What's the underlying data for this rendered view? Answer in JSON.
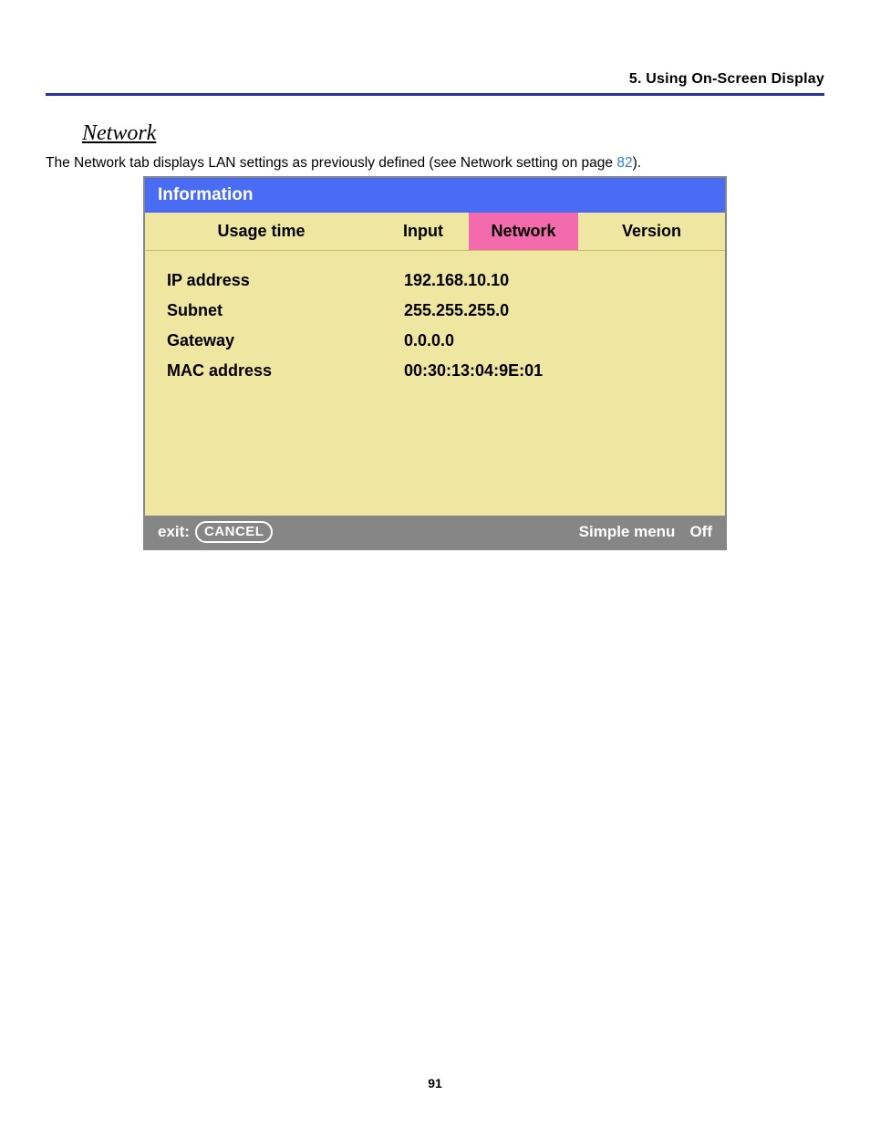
{
  "header": {
    "chapter": "5. Using On-Screen Display"
  },
  "section": {
    "title": "Network",
    "intro_pre": "The Network tab displays LAN settings as previously defined (see Network setting on page ",
    "intro_link": "82",
    "intro_post": ")."
  },
  "osd": {
    "title": "Information",
    "tabs": {
      "usage": "Usage time",
      "input": "Input",
      "network": "Network",
      "version": "Version"
    },
    "rows": {
      "ip_label": "IP address",
      "ip_value": "192.168.10.10",
      "subnet_label": "Subnet",
      "subnet_value": "255.255.255.0",
      "gateway_label": "Gateway",
      "gateway_value": "0.0.0.0",
      "mac_label": "MAC address",
      "mac_value": "00:30:13:04:9E:01"
    },
    "footer": {
      "exit_label": "exit:",
      "cancel_button": "CANCEL",
      "simple_menu_label": "Simple menu",
      "simple_menu_value": "Off"
    }
  },
  "page_number": "91"
}
